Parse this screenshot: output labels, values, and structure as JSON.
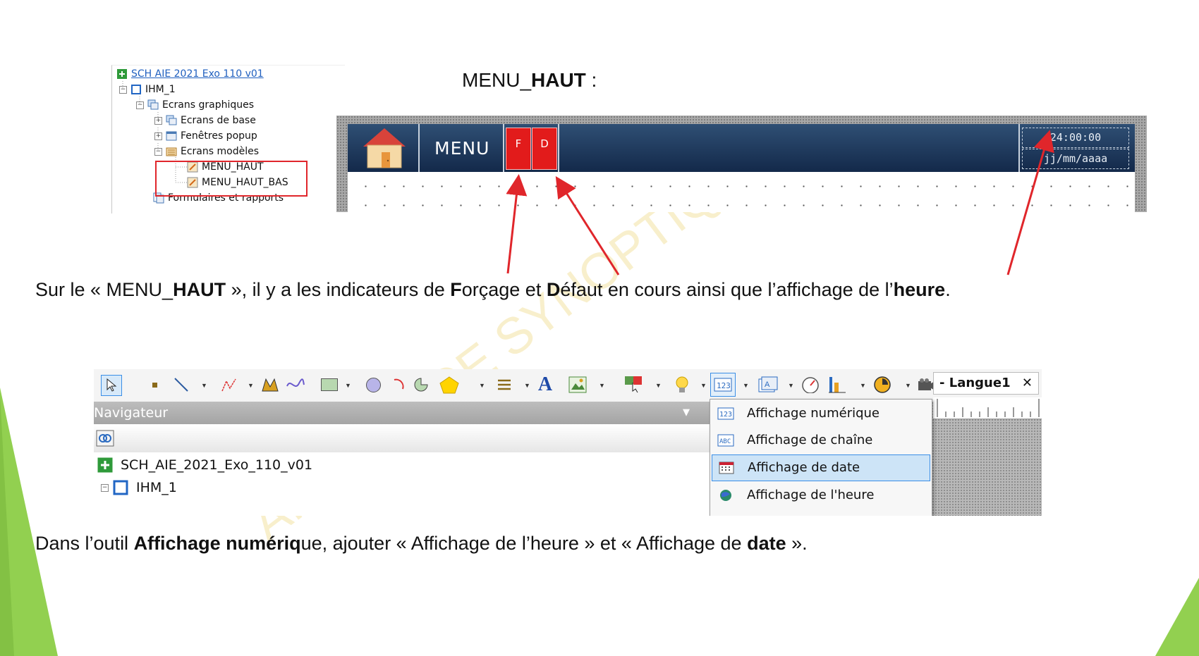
{
  "tree1": {
    "project": "SCH AIE 2021 Exo 110 v01",
    "items": [
      "IHM_1",
      "Ecrans graphiques",
      "Ecrans de base",
      "Fenêtres popup",
      "Ecrans modèles",
      "MENU_HAUT",
      "MENU_HAUT_BAS",
      "Formulaires et rapports"
    ]
  },
  "menu_title": {
    "normal": "MENU_",
    "bold": "HAUT",
    "suffix": " :"
  },
  "menu_screen": {
    "menu_label": "MENU",
    "indicator_f": "F",
    "indicator_d": "D",
    "time": "24:00:00",
    "date": "jj/mm/aaaa"
  },
  "sentence1": {
    "p1": "Sur le « MENU_",
    "b1": "HAUT",
    "p2": " », il y a les indicateurs de ",
    "b2": "F",
    "p3": "orçage et ",
    "b3": "D",
    "p4": "éfaut en cours ainsi que l’affichage de l’",
    "b4": "heure",
    "p5": "."
  },
  "toolbar_shot": {
    "navigator_label": "Navigateur",
    "tab_label": "- Langue1",
    "tree_project": "SCH_AIE_2021_Exo_110_v01",
    "tree_item": "IHM_1",
    "menu_items": [
      "Affichage numérique",
      "Affichage de chaîne",
      "Affichage de date",
      "Affichage de l'heure"
    ],
    "selected_item": "Affichage de date"
  },
  "sentence2": {
    "p1": "Dans l’outil ",
    "b1": "Affichage numériq",
    "p2": "ue, ajouter « Affichage de l’heure » et « Affichage de ",
    "b2": "date",
    "p3": " »."
  },
  "watermark_text": "AFFICHAGE SYNOPTIQUES",
  "colors": {
    "accent_green": "#92d050",
    "highlight_red": "#e0262b",
    "menubar_blue": "#1a3558",
    "indicator_red": "#e21b1b",
    "selection_blue": "#cde4f7"
  }
}
